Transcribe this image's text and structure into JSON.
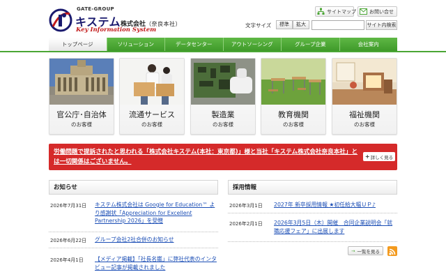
{
  "header": {
    "gate_group": "GATE-GROUP",
    "brand": "キステム",
    "company_suffix": "株式会社",
    "branch": "（奈良本社）",
    "tagline": "Key Information System",
    "sitemap_label": "サイトマップ",
    "contact_label": "お問い合せ",
    "font_size_label": "文字サイズ",
    "font_standard": "標準",
    "font_large": "拡大",
    "search_value": "",
    "search_button": "サイト内検索"
  },
  "nav": {
    "items": [
      {
        "label": "トップページ",
        "active": true
      },
      {
        "label": "ソリューション",
        "active": false
      },
      {
        "label": "データセンター",
        "active": false
      },
      {
        "label": "アウトソーシング",
        "active": false
      },
      {
        "label": "グループ企業",
        "active": false
      },
      {
        "label": "会社案内",
        "active": false
      }
    ]
  },
  "categories": [
    {
      "title": "官公庁･自治体",
      "subtitle": "のお客様"
    },
    {
      "title": "流通サービス",
      "subtitle": "のお客様"
    },
    {
      "title": "製造業",
      "subtitle": "のお客様"
    },
    {
      "title": "教育機関",
      "subtitle": "のお客様"
    },
    {
      "title": "福祉機関",
      "subtitle": "のお客様"
    }
  ],
  "notice": {
    "text": "労働問題で提訴されたと思われる「株式会社キステム(本社：東京都)」様と当社「キステム株式会社奈良本社」とは一切関係はございません。",
    "button": "詳しく見る",
    "bg_color": "#d52a2a"
  },
  "news": {
    "title": "お知らせ",
    "items": [
      {
        "date": "2026年7月31日",
        "title": "キステム株式会社は Google for Education™ より感謝状「Appreciation for Excellent Partnership 2026」を受贈"
      },
      {
        "date": "2026年6月22日",
        "title": "グループ会社2社合併のお知らせ"
      },
      {
        "date": "2026年4月1日",
        "title": "【メディア掲載】「社長名鑑」に弊社代表のインタビュー記事が掲載されました"
      }
    ]
  },
  "recruit": {
    "title": "採用情報",
    "items": [
      {
        "date": "2026年3月1日",
        "title": "2027年 新卒採用情報 ★初任給大幅ＵＰ♪"
      },
      {
        "date": "2026年2月1日",
        "title": "2026年3月5日（木）開催　合同企業説明会「就職応援フェア」に出展します"
      }
    ],
    "more_label": "一覧を見る"
  },
  "colors": {
    "nav_green": "#4aa634",
    "link_blue": "#1a4db5",
    "brand_navy": "#1a1a6e",
    "tagline_red": "#c21a1a",
    "rss_orange": "#f39a1e"
  }
}
